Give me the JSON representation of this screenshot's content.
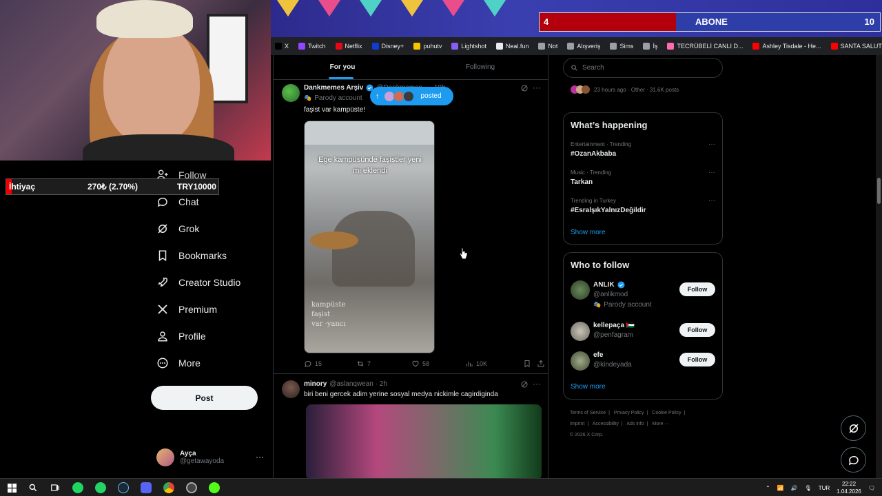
{
  "overlay": {
    "abone_count_left": "4",
    "abone_label": "ABONE",
    "abone_goal": "10",
    "abone_progress": 0.4,
    "ihtiyac_label": "İhtiyaç",
    "ihtiyac_amount": "270₺ (2.70%)",
    "ihtiyac_goal": "TRY10000",
    "ihtiyac_progress": 0.027
  },
  "bookmarks": [
    {
      "label": "X",
      "color": "#000000"
    },
    {
      "label": "Twitch",
      "color": "#9146ff"
    },
    {
      "label": "Netflix",
      "color": "#e50914"
    },
    {
      "label": "Disney+",
      "color": "#113ccf"
    },
    {
      "label": "puhutv",
      "color": "#f7c600"
    },
    {
      "label": "Lightshot",
      "color": "#8a5cf6"
    },
    {
      "label": "Neal.fun",
      "color": "#e8eaed"
    },
    {
      "label": "Not",
      "color": "#9aa0a6"
    },
    {
      "label": "Alışveriş",
      "color": "#9aa0a6"
    },
    {
      "label": "Sims",
      "color": "#9aa0a6"
    },
    {
      "label": "İş",
      "color": "#9aa0a6"
    },
    {
      "label": "TECRÜBELİ CANLI D...",
      "color": "#ff6ab0"
    },
    {
      "label": "Ashley Tisdale - He...",
      "color": "#ff0000"
    },
    {
      "label": "SANTA SALUT - CYP...",
      "color": "#ff0000"
    }
  ],
  "nav": {
    "items": [
      {
        "label": "Follow",
        "icon": "follow-icon"
      },
      {
        "label": "Chat",
        "icon": "chat-icon"
      },
      {
        "label": "Grok",
        "icon": "grok-icon"
      },
      {
        "label": "Bookmarks",
        "icon": "bookmark-icon"
      },
      {
        "label": "Creator Studio",
        "icon": "rocket-icon"
      },
      {
        "label": "Premium",
        "icon": "x-logo-icon"
      },
      {
        "label": "Profile",
        "icon": "profile-icon"
      },
      {
        "label": "More",
        "icon": "more-circle-icon"
      }
    ],
    "post_label": "Post",
    "account_name": "Ayça",
    "account_handle": "@getawayoda",
    "account_more": "···"
  },
  "timeline": {
    "tabs": [
      "For you",
      "Following"
    ],
    "posted_pill": "posted",
    "tweet1": {
      "name": "Dankmemes Arşiv",
      "handle_time": "@Dankmemes... · 19h",
      "badge": "Parody account",
      "text": "faşist var kampüste!",
      "media_caption": "Ege kampüsünde faşistler yeni mi eklendi",
      "media_watermark": "kampüste\nfaşist\nvar ·yancı",
      "replies": "15",
      "reposts": "7",
      "likes": "58",
      "views": "10K"
    },
    "tweet2": {
      "name": "minory",
      "handle_time": "@aslanqwean · 2h",
      "text": "biri beni gercek adim yerine sosyal medya nickimle cagirdiginda"
    }
  },
  "sidebar": {
    "search_placeholder": "Search",
    "top_trend_meta": "23 hours ago · Other · 31.6K posts",
    "happening_title": "What’s happening",
    "trends": [
      {
        "category": "Entertainment · Trending",
        "name": "#OzanAkbaba"
      },
      {
        "category": "Music · Trending",
        "name": "Tarkan"
      },
      {
        "category": "Trending in Turkey",
        "name": "#EsralşıkYalnızDeğildir"
      }
    ],
    "show_more": "Show more",
    "wtf_title": "Who to follow",
    "wtf": [
      {
        "name": "ANLIK",
        "handle": "@anlikmod",
        "sub": "Parody account",
        "button": "Follow"
      },
      {
        "name": "kellepaça 🇵🇸",
        "handle": "@penfagram",
        "sub": "",
        "button": "Follow"
      },
      {
        "name": "efe",
        "handle": "@kindeyada",
        "sub": "",
        "button": "Follow"
      }
    ],
    "footer": [
      "Terms of Service",
      "|",
      "Privacy Policy",
      "|",
      "Cookie Policy",
      "|",
      "Imprint",
      "|",
      "Accessibility",
      "|",
      "Ads info",
      "|",
      "More ···",
      "© 2026 X Corp."
    ]
  },
  "taskbar": {
    "lang": "TUR",
    "time": "22:22",
    "date": "1.04.2026"
  }
}
